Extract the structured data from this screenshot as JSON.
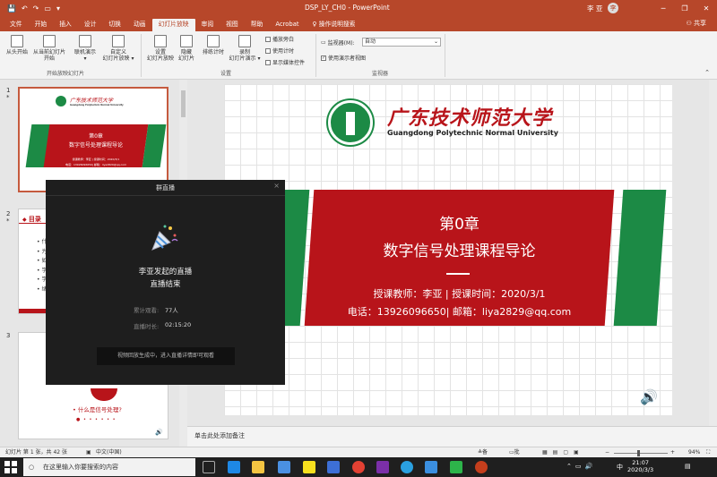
{
  "titlebar": {
    "document": "DSP_LY_CH0 - PowerPoint",
    "user": "李 亚",
    "avatar": "李",
    "minimize": "─",
    "restore": "❐",
    "close": "✕"
  },
  "tabs": [
    {
      "label": "文件"
    },
    {
      "label": "开始"
    },
    {
      "label": "插入"
    },
    {
      "label": "设计"
    },
    {
      "label": "切换"
    },
    {
      "label": "动画"
    },
    {
      "label": "幻灯片放映",
      "active": true
    },
    {
      "label": "审阅"
    },
    {
      "label": "视图"
    },
    {
      "label": "帮助"
    },
    {
      "label": "Acrobat"
    }
  ],
  "tab_search": "操作说明搜索",
  "share": "共享",
  "ribbon": {
    "from_start": "从头开始",
    "from_current_line1": "从当前幻灯片",
    "from_current_line2": "开始",
    "online_line1": "联机演示",
    "online_line2": "▾",
    "custom_line1": "自定义",
    "custom_line2": "幻灯片放映 ▾",
    "group_start": "开始放映幻灯片",
    "setup_line1": "设置",
    "setup_line2": "幻灯片放映",
    "hide_line1": "隐藏",
    "hide_line2": "幻灯片",
    "rehearse": "排练计时",
    "record_line1": "录制",
    "record_line2": "幻灯片演示 ▾",
    "chk_narration": "播放旁白",
    "chk_timing": "使用计时",
    "chk_media": "显示媒体控件",
    "group_setup": "设置",
    "monitor_label": "监视器(M):",
    "monitor_value": "自动",
    "presenter_view": "使用演示者视图",
    "group_monitor": "监视器"
  },
  "thumbnails": {
    "n1": "1",
    "n2": "2",
    "n3": "3",
    "star": "*",
    "t1_chapter": "第0章",
    "t1_title": "数字信号处理课程导论",
    "t1_teacher": "授课教师：李亚 | 授课时间：2020/3/1",
    "t1_contact": "电话：13926096650| 邮箱：liya2829@qq.com",
    "t2_header": "目录",
    "t2_bullets": [
      "什",
      "为",
      "如",
      "学",
      "学",
      "绪"
    ],
    "t3_caption": "• 什么是信号处理?"
  },
  "slide": {
    "uni_cn": "广东技术师范大学",
    "uni_en": "Guangdong Polytechnic Normal University",
    "chapter": "第0章",
    "title": "数字信号处理课程导论",
    "teacher": "授课教师：李亚  | 授课时间：2020/3/1",
    "contact": "电话：13926096650| 邮箱：liya2829@qq.com"
  },
  "colors": {
    "accent": "#b7472a",
    "slide_red": "#b8141a",
    "slide_green": "#1c8a45"
  },
  "live": {
    "header": "群直播",
    "host_line": "李亚发起的直播",
    "ended": "直播结束",
    "views_label": "累计观看:",
    "views_value": "77人",
    "duration_label": "直播时长:",
    "duration_value": "02:15:20",
    "replay_msg": "视频回放生成中，进入直播详情即可观看"
  },
  "notes_placeholder": "单击此处添加备注",
  "status": {
    "slide_info": "幻灯片 第 1 张，共 42 张",
    "language": "中文(中国)",
    "notes": "备注",
    "comments": "批注",
    "zoom": "94%"
  },
  "taskbar": {
    "search_placeholder": "在这里输入你要搜索的内容",
    "ime": "中",
    "time": "21:07",
    "date": "2020/3/3"
  }
}
